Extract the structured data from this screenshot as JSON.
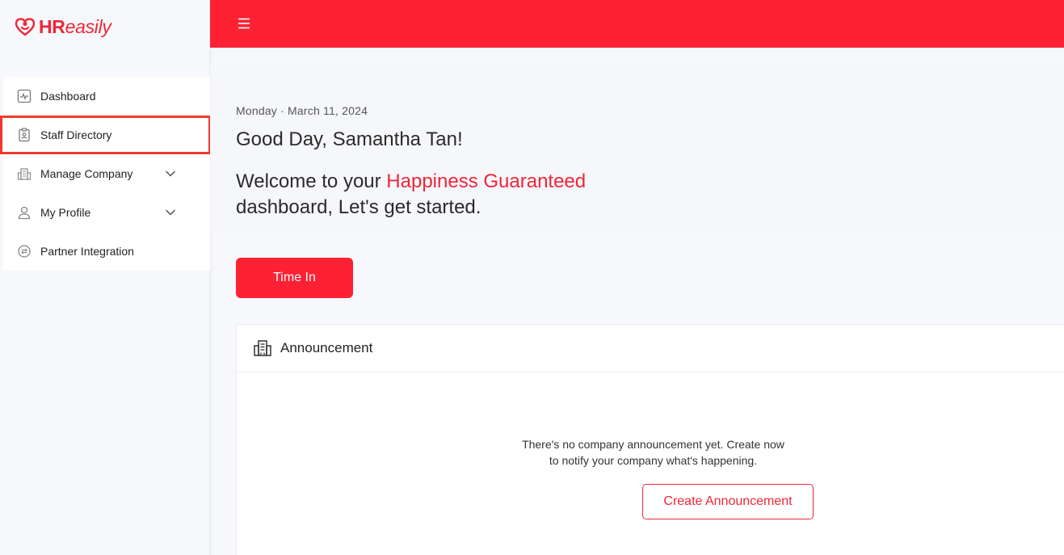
{
  "brand": {
    "name_bold": "HR",
    "name_italic": "easily",
    "accent_color": "#fc2234"
  },
  "sidebar": {
    "items": [
      {
        "label": "Dashboard",
        "icon": "activity-chart-icon"
      },
      {
        "label": "Staff Directory",
        "icon": "id-badge-icon",
        "highlighted": true
      },
      {
        "label": "Manage Company",
        "icon": "building-icon",
        "expandable": true
      },
      {
        "label": "My Profile",
        "icon": "user-icon",
        "expandable": true
      },
      {
        "label": "Partner Integration",
        "icon": "swap-circle-icon"
      }
    ]
  },
  "topbar": {
    "menu_icon": "hamburger-icon"
  },
  "hero": {
    "date": "Monday · March 11, 2024",
    "greeting": "Good Day, Samantha Tan!",
    "welcome_prefix": "Welcome to your ",
    "welcome_accent": "Happiness Guaranteed",
    "welcome_suffix": "dashboard, Let's get started."
  },
  "actions": {
    "time_in_label": "Time In"
  },
  "announcement": {
    "title": "Announcement",
    "icon": "office-building-icon",
    "empty_line1": "There's no company announcement yet. Create now",
    "empty_line2": "to notify your company what's happening.",
    "create_label": "Create Announcement"
  }
}
